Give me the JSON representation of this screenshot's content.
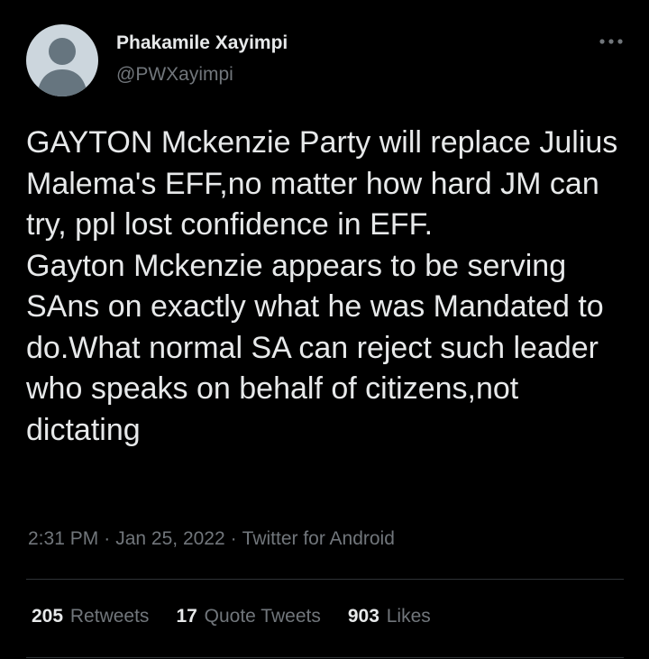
{
  "author": {
    "name": "Phakamile Xayimpi",
    "handle": "@PWXayimpi",
    "avatar_icon": "default-profile-silhouette-icon",
    "avatar_bg": "#ccd6dd",
    "avatar_fg": "#66757f"
  },
  "more_menu": {
    "icon": "more-horizontal-icon"
  },
  "tweet": {
    "text": "GAYTON Mckenzie Party will replace Julius Malema's EFF,no matter how hard JM can try, ppl lost confidence in EFF.\nGayton Mckenzie appears to be serving SAns on exactly what he was Mandated to do.What normal SA can reject such leader who speaks on behalf of citizens,not dictating"
  },
  "meta": {
    "time": "2:31 PM",
    "separator": "·",
    "date": "Jan 25, 2022",
    "source": "Twitter for Android"
  },
  "stats": [
    {
      "count": "205",
      "label": "Retweets"
    },
    {
      "count": "17",
      "label": "Quote Tweets"
    },
    {
      "count": "903",
      "label": "Likes"
    }
  ],
  "colors": {
    "background": "#000000",
    "primary_text": "#e7e9ea",
    "secondary_text": "#71767b",
    "divider": "#2f3336"
  }
}
